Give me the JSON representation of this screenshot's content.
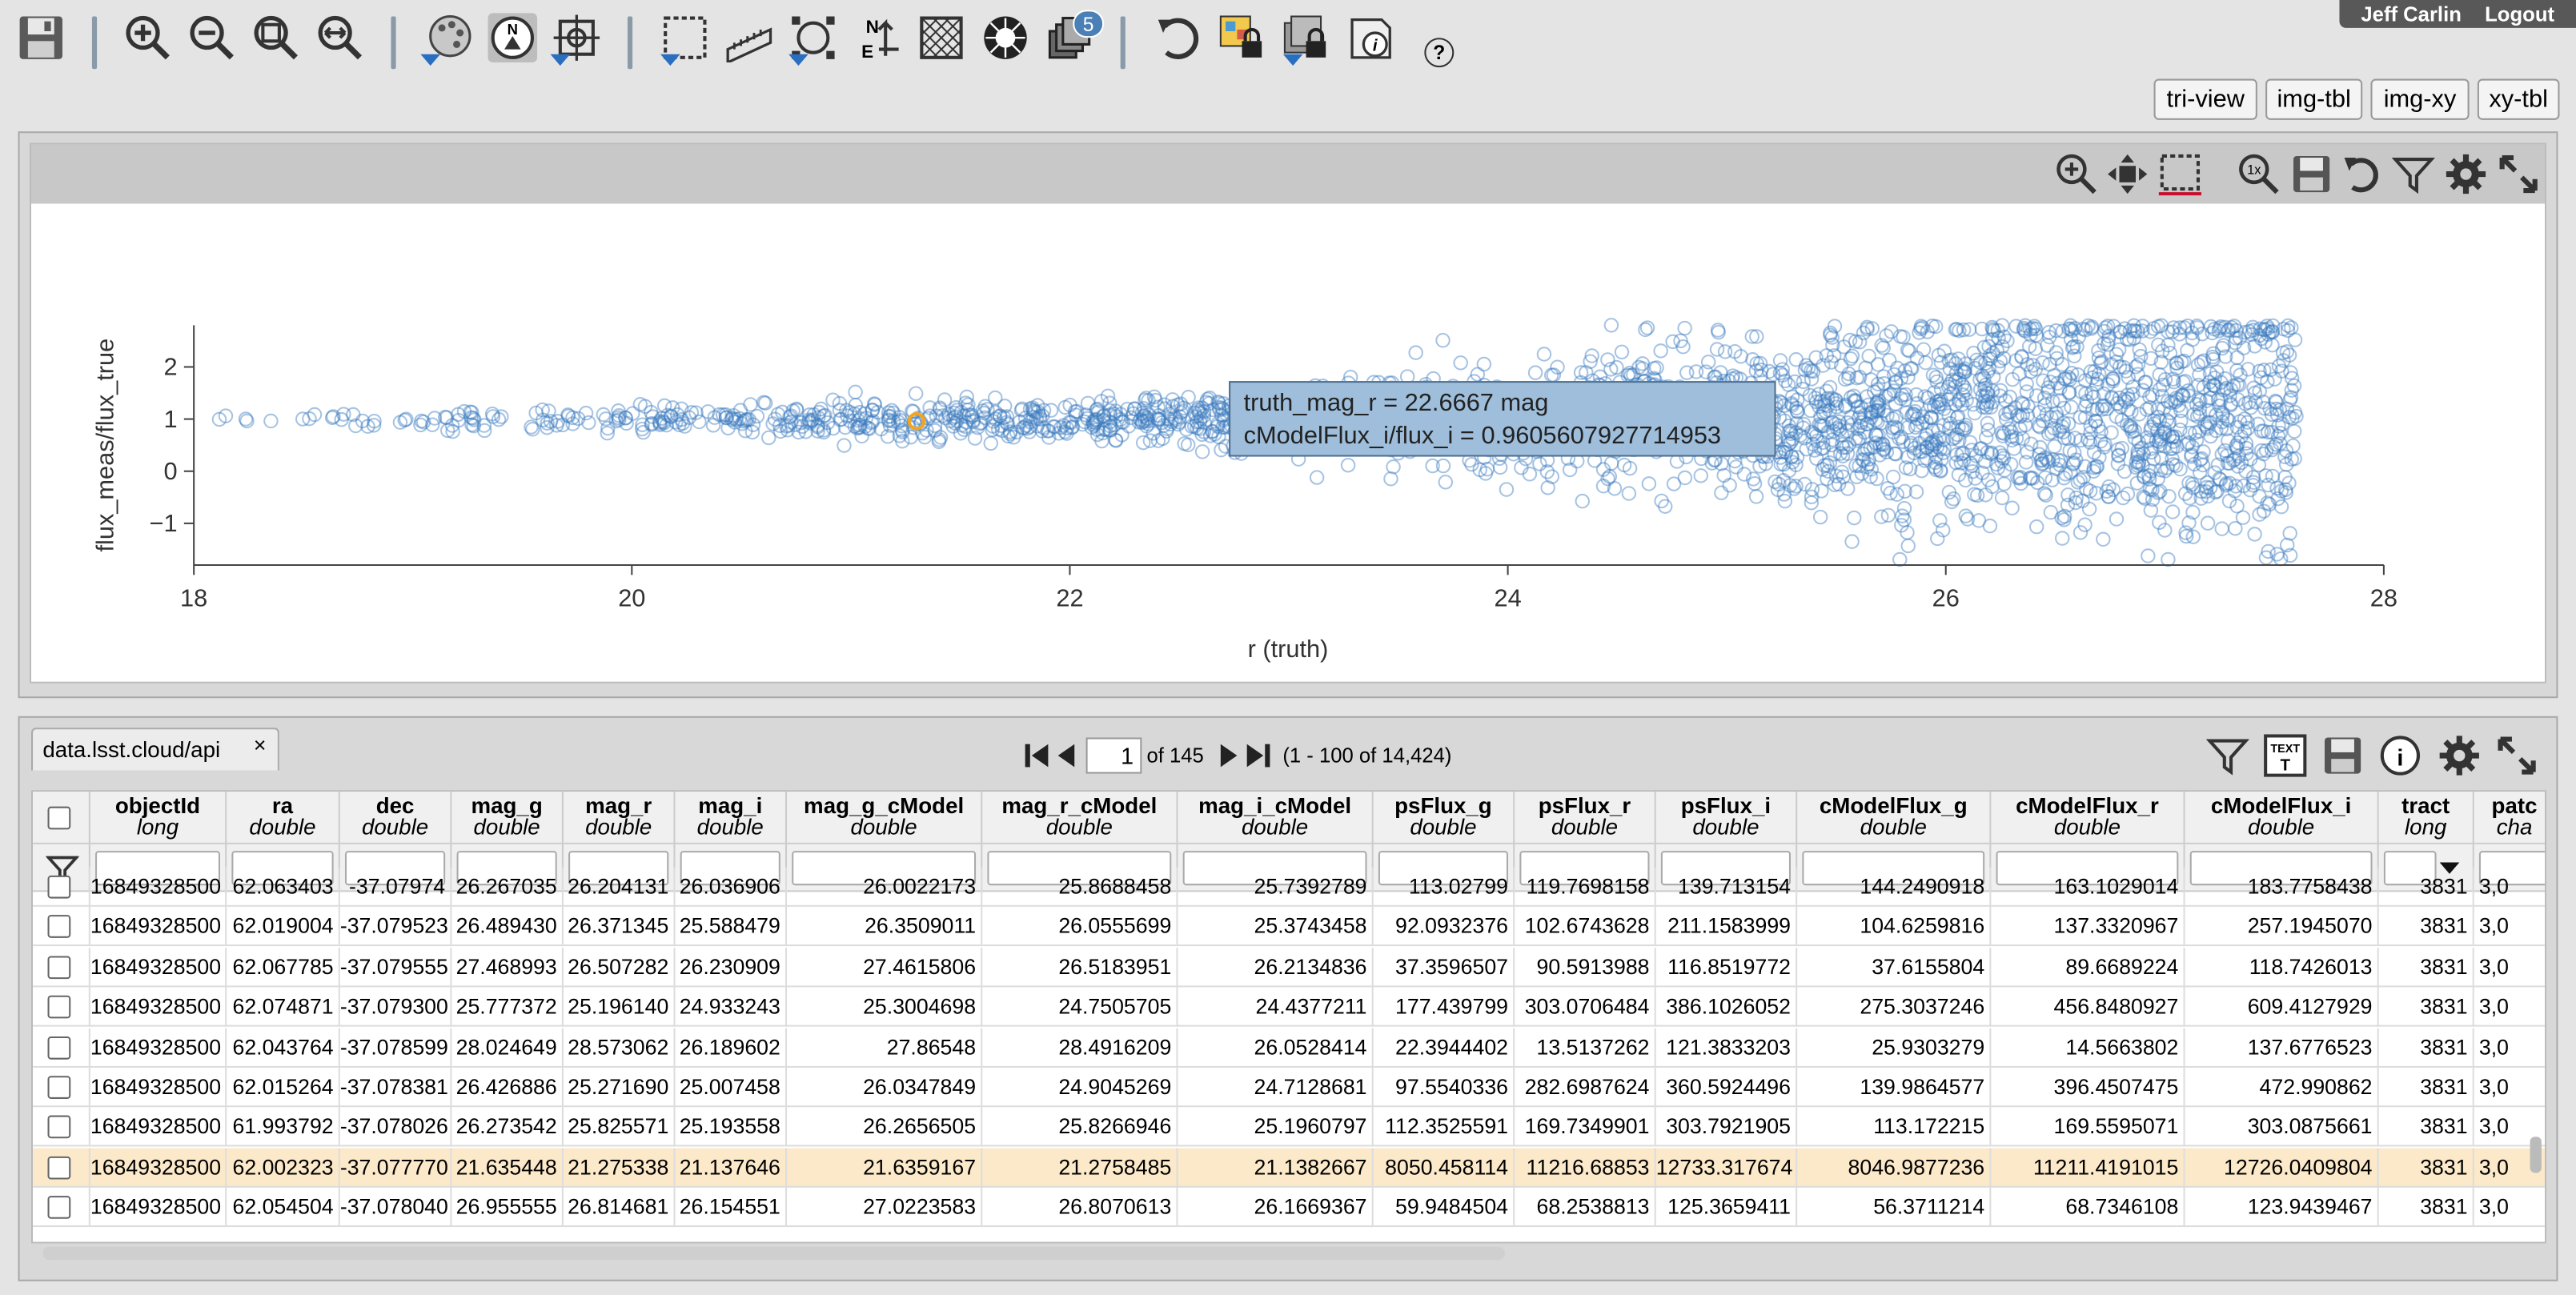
{
  "user": {
    "name": "Jeff Carlin",
    "logout": "Logout"
  },
  "toolbar": {
    "icons": [
      "save-icon",
      "zoom-in-icon",
      "zoom-out-icon",
      "zoom-fit-icon",
      "zoom-fill-icon",
      "color-stretch-icon",
      "north-arrow-icon",
      "target-icon",
      "select-area-icon",
      "distance-tool-icon",
      "marker-icon",
      "flip-icon",
      "grid-icon",
      "starburst-icon",
      "layers-icon",
      "rotate-icon",
      "lock-image-icon",
      "lock-overlay-icon",
      "image-info-icon",
      "help-icon"
    ],
    "layers_badge": "5",
    "help": "?"
  },
  "view_buttons": [
    "tri-view",
    "img-tbl",
    "img-xy",
    "xy-tbl"
  ],
  "chart": {
    "icons": [
      "zoom-icon",
      "pan-icon",
      "select-icon",
      "reset-zoom-icon",
      "save-chart-icon",
      "restore-icon",
      "filter-icon",
      "settings-icon",
      "expand-icon"
    ],
    "ylabel": "flux_meas/flux_true",
    "xlabel": "r (truth)",
    "xticks": [
      "18",
      "20",
      "22",
      "24",
      "26",
      "28"
    ],
    "yticks": [
      "2",
      "1",
      "0",
      "−1"
    ],
    "tooltip": {
      "line1": "truth_mag_r = 22.6667 mag",
      "line2": "cModelFlux_i/flux_i = 0.9605607927714953"
    }
  },
  "chart_data": {
    "type": "scatter",
    "title": "",
    "xlabel": "r (truth)",
    "ylabel": "flux_meas/flux_true",
    "xlim": [
      18,
      28
    ],
    "ylim": [
      -1.8,
      2.8
    ],
    "x_ticks": [
      18,
      20,
      22,
      24,
      26,
      28
    ],
    "y_ticks": [
      -1,
      0,
      1,
      2
    ],
    "grid": false,
    "point_color": "#3a7abf",
    "highlight_color": "#f2a51f",
    "highlight_point": {
      "x": 21.3,
      "y": 0.96
    },
    "tooltip_point": {
      "x": 22.6667,
      "y": 0.9605607927714953
    }
  },
  "table": {
    "tab_label": "data.lsst.cloud/api",
    "tab_close": "×",
    "page": "1",
    "of_pages": "of 145",
    "range": "(1 - 100 of 14,424)",
    "icons": [
      "filter-icon",
      "text-view-icon",
      "save-table-icon",
      "info-icon",
      "settings-icon",
      "expand-icon"
    ],
    "columns": [
      {
        "name": "objectId",
        "type": "long"
      },
      {
        "name": "ra",
        "type": "double"
      },
      {
        "name": "dec",
        "type": "double"
      },
      {
        "name": "mag_g",
        "type": "double"
      },
      {
        "name": "mag_r",
        "type": "double"
      },
      {
        "name": "mag_i",
        "type": "double"
      },
      {
        "name": "mag_g_cModel",
        "type": "double"
      },
      {
        "name": "mag_r_cModel",
        "type": "double"
      },
      {
        "name": "mag_i_cModel",
        "type": "double"
      },
      {
        "name": "psFlux_g",
        "type": "double"
      },
      {
        "name": "psFlux_r",
        "type": "double"
      },
      {
        "name": "psFlux_i",
        "type": "double"
      },
      {
        "name": "cModelFlux_g",
        "type": "double"
      },
      {
        "name": "cModelFlux_r",
        "type": "double"
      },
      {
        "name": "cModelFlux_i",
        "type": "double"
      },
      {
        "name": "tract",
        "type": "long"
      },
      {
        "name": "patc",
        "type": "cha"
      }
    ],
    "rows": [
      [
        "16849328500",
        "62.063403",
        "-37.07974",
        "26.267035",
        "26.204131",
        "26.036906",
        "26.0022173",
        "25.8688458",
        "25.7392789",
        "113.02799",
        "119.7698158",
        "139.713154",
        "144.2490918",
        "163.1029014",
        "183.7758438",
        "3831",
        "3,0"
      ],
      [
        "16849328500",
        "62.019004",
        "-37.079523",
        "26.489430",
        "26.371345",
        "25.588479",
        "26.3509011",
        "26.0555699",
        "25.3743458",
        "92.0932376",
        "102.6743628",
        "211.1583999",
        "104.6259816",
        "137.3320967",
        "257.1945070",
        "3831",
        "3,0"
      ],
      [
        "16849328500",
        "62.067785",
        "-37.079555",
        "27.468993",
        "26.507282",
        "26.230909",
        "27.4615806",
        "26.5183951",
        "26.2134836",
        "37.3596507",
        "90.5913988",
        "116.8519772",
        "37.6155804",
        "89.6689224",
        "118.7426013",
        "3831",
        "3,0"
      ],
      [
        "16849328500",
        "62.074871",
        "-37.079300",
        "25.777372",
        "25.196140",
        "24.933243",
        "25.3004698",
        "24.7505705",
        "24.4377211",
        "177.439799",
        "303.0706484",
        "386.1026052",
        "275.3037246",
        "456.8480927",
        "609.4127929",
        "3831",
        "3,0"
      ],
      [
        "16849328500",
        "62.043764",
        "-37.078599",
        "28.024649",
        "28.573062",
        "26.189602",
        "27.86548",
        "28.4916209",
        "26.0528414",
        "22.3944402",
        "13.5137262",
        "121.3833203",
        "25.9303279",
        "14.5663802",
        "137.6776523",
        "3831",
        "3,0"
      ],
      [
        "16849328500",
        "62.015264",
        "-37.078381",
        "26.426886",
        "25.271690",
        "25.007458",
        "26.0347849",
        "24.9045269",
        "24.7128681",
        "97.5540336",
        "282.6987624",
        "360.5924496",
        "139.9864577",
        "396.4507475",
        "472.990862",
        "3831",
        "3,0"
      ],
      [
        "16849328500",
        "61.993792",
        "-37.078026",
        "26.273542",
        "25.825571",
        "25.193558",
        "26.2656505",
        "25.8266946",
        "25.1960797",
        "112.3525591",
        "169.7349901",
        "303.7921905",
        "113.172215",
        "169.5595071",
        "303.0875661",
        "3831",
        "3,0"
      ],
      [
        "16849328500",
        "62.002323",
        "-37.077770",
        "21.635448",
        "21.275338",
        "21.137646",
        "21.6359167",
        "21.2758485",
        "21.1382667",
        "8050.458114",
        "11216.68853",
        "12733.317674",
        "8046.9877236",
        "11211.4191015",
        "12726.0409804",
        "3831",
        "3,0"
      ],
      [
        "16849328500",
        "62.054504",
        "-37.078040",
        "26.955555",
        "26.814681",
        "26.154551",
        "27.0223583",
        "26.8070613",
        "26.1669367",
        "59.9484504",
        "68.2538813",
        "125.3659411",
        "56.3711214",
        "68.7346108",
        "123.9439467",
        "3831",
        "3,0"
      ]
    ],
    "selected_row": 7
  }
}
